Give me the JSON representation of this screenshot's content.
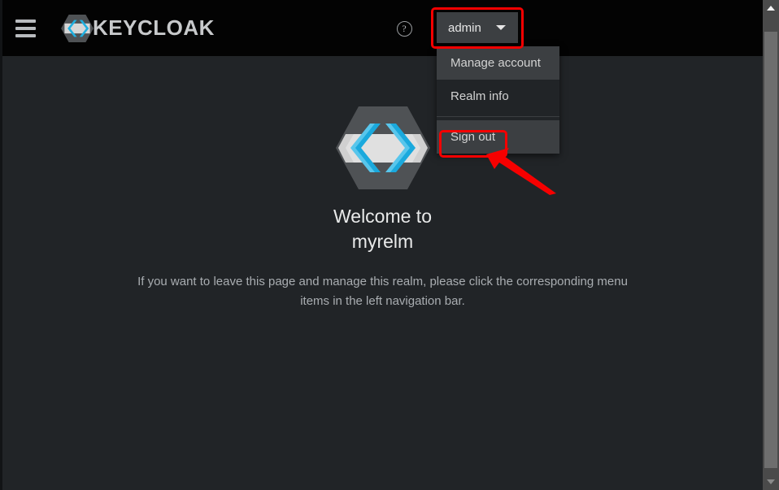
{
  "app": {
    "brand_name": "KEYCLOAK",
    "background_color": "#212427",
    "masthead_color": "#030303",
    "accent_color": "#00b8e6",
    "annotation_color": "#f60000"
  },
  "masthead": {
    "nav_toggle_name": "hamburger-icon",
    "help_icon_label": "?",
    "help_icon_name": "help-icon",
    "user_toggle_label": "admin",
    "avatar_name": "user-avatar"
  },
  "user_dropdown": {
    "expanded": true,
    "items": [
      {
        "label": "Manage account",
        "highlighted": true
      },
      {
        "label": "Realm info",
        "highlighted": false
      },
      {
        "label": "Sign out",
        "highlighted": true,
        "separator_above": true
      }
    ]
  },
  "main": {
    "logo_name": "keycloak-logo-large",
    "welcome_line1": "Welcome to",
    "welcome_line2": "myrelm",
    "description": "If you want to leave this page and manage this realm, please click the corresponding menu items in the left navigation bar."
  },
  "scrollbar": {
    "up_arrow_name": "scroll-up-arrow",
    "down_arrow_name": "scroll-down-arrow",
    "thumb_name": "scrollbar-thumb"
  },
  "annotations": [
    {
      "target": "user-toggle",
      "shape": "rectangle"
    },
    {
      "target": "sign-out-item",
      "shape": "rectangle"
    },
    {
      "target": "sign-out-item",
      "shape": "arrow"
    }
  ]
}
